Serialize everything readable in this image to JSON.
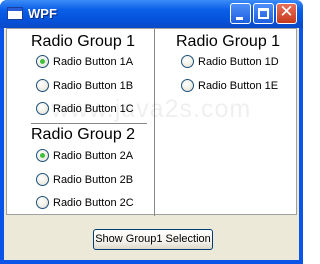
{
  "window": {
    "title": "WPF"
  },
  "left": {
    "group1": {
      "title": "Radio Group 1",
      "items": [
        {
          "label": "Radio Button 1A",
          "checked": true
        },
        {
          "label": "Radio Button 1B",
          "checked": false
        },
        {
          "label": "Radio Button 1C",
          "checked": false
        }
      ]
    },
    "group2": {
      "title": "Radio Group 2",
      "items": [
        {
          "label": "Radio Button 2A",
          "checked": true
        },
        {
          "label": "Radio Button 2B",
          "checked": false
        },
        {
          "label": "Radio Button 2C",
          "checked": false
        }
      ]
    }
  },
  "right": {
    "group1": {
      "title": "Radio Group 1",
      "items": [
        {
          "label": "Radio Button 1D",
          "checked": false
        },
        {
          "label": "Radio Button 1E",
          "checked": false
        }
      ]
    }
  },
  "watermark": "www.java2s.com",
  "button": {
    "label": "Show Group1 Selection"
  }
}
